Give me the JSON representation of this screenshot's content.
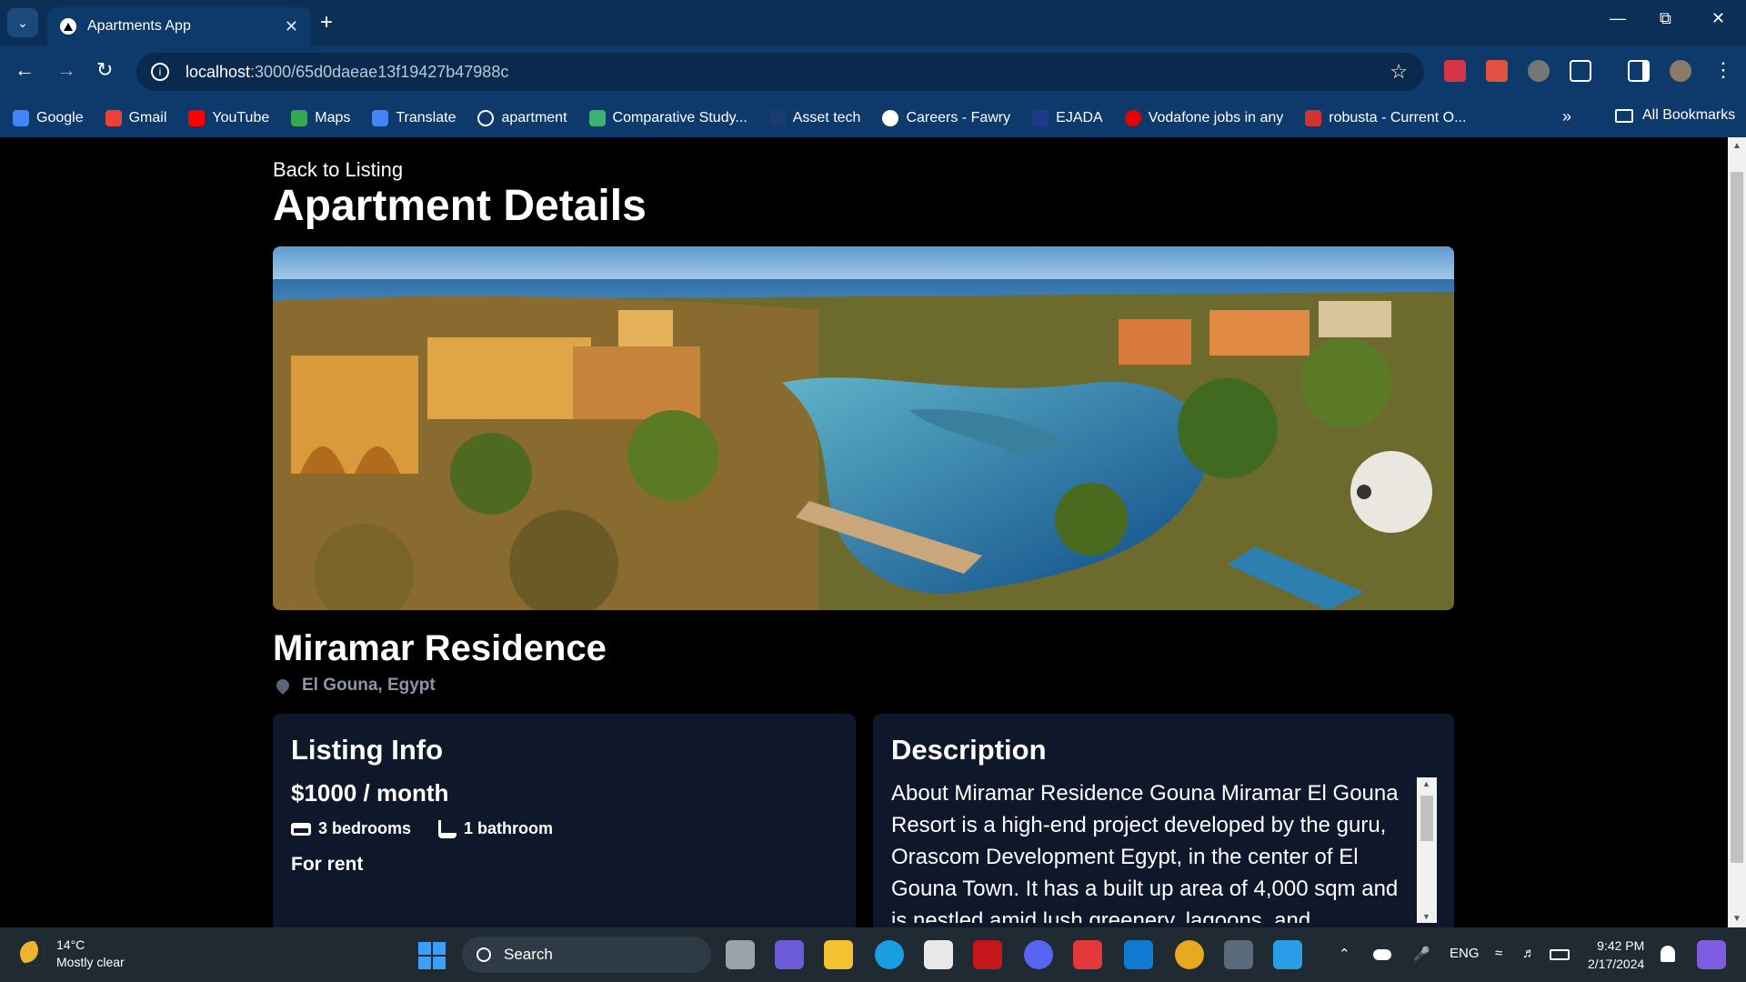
{
  "browser": {
    "tab_title": "Apartments App",
    "url_host": "localhost",
    "url_path": ":3000/65d0daeae13f19427b47988c",
    "bookmarks": [
      {
        "label": "Google",
        "color": "#4285f4"
      },
      {
        "label": "Gmail",
        "color": "#ea4335"
      },
      {
        "label": "YouTube",
        "color": "#ff0000"
      },
      {
        "label": "Maps",
        "color": "#34a853"
      },
      {
        "label": "Translate",
        "color": "#4285f4"
      },
      {
        "label": "apartment",
        "color": "#222222"
      },
      {
        "label": "Comparative Study...",
        "color": "#3cb371"
      },
      {
        "label": "Asset tech",
        "color": "#1a3c6b"
      },
      {
        "label": "Careers - Fawry",
        "color": "#ffffff"
      },
      {
        "label": "EJADA",
        "color": "#1e3a8a"
      },
      {
        "label": "Vodafone jobs in any",
        "color": "#e60000"
      },
      {
        "label": "robusta - Current O...",
        "color": "#d0342c"
      }
    ],
    "all_bookmarks": "All Bookmarks"
  },
  "page": {
    "back_link": "Back to Listing",
    "title": "Apartment Details",
    "apartment_name": "Miramar Residence",
    "location": "El Gouna, Egypt",
    "listing_info": {
      "heading": "Listing Info",
      "price": "$1000 / month",
      "bedrooms": "3 bedrooms",
      "bathrooms": "1 bathroom",
      "status": "For rent"
    },
    "description": {
      "heading": "Description",
      "text": "About Miramar Residence Gouna Miramar El Gouna Resort is a high-end project developed by the guru, Orascom Development Egypt, in the center of El Gouna Town. It has a built up area of 4,000 sqm and is nestled amid lush greenery, lagoons, and breathtaking"
    }
  },
  "taskbar": {
    "temperature": "14°C",
    "weather": "Mostly clear",
    "search_placeholder": "Search",
    "language": "ENG",
    "time": "9:42 PM",
    "date": "2/17/2024"
  }
}
